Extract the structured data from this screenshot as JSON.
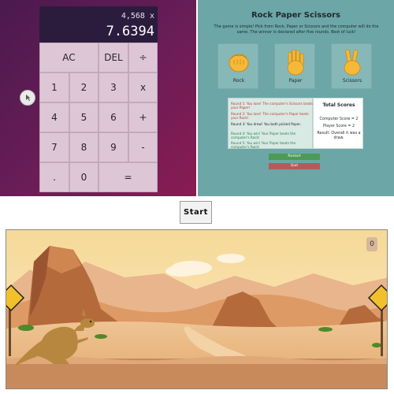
{
  "calculator": {
    "previous_operand": "4,568 x",
    "current_operand": "7.6394",
    "keys": {
      "ac": "AC",
      "del": "DEL",
      "divide": "÷",
      "one": "1",
      "two": "2",
      "three": "3",
      "multiply": "x",
      "four": "4",
      "five": "5",
      "six": "6",
      "add": "+",
      "seven": "7",
      "eight": "8",
      "nine": "9",
      "subtract": "-",
      "dot": ".",
      "zero": "0",
      "equals": "="
    },
    "colors": {
      "display": "#2b1c3e",
      "keys": "#ddc7d6",
      "background_from": "#4a1a4e",
      "background_to": "#8a1b52"
    }
  },
  "rps": {
    "title": "Rock Paper Scissors",
    "description": "The game is simple! Pick from Rock, Paper or Scissors and the computer will do the same. The winner is declared after five rounds. Best of luck!",
    "choices": [
      {
        "label": "Rock",
        "icon": "fist-icon"
      },
      {
        "label": "Paper",
        "icon": "open-hand-icon"
      },
      {
        "label": "Scissors",
        "icon": "victory-hand-icon"
      }
    ],
    "log": [
      {
        "text": "Round 1: You lose! The computer's Scissors beats your Paper!",
        "color": "#c0392b"
      },
      {
        "text": "Round 2: You lose! The computer's Paper beats your Rock!",
        "color": "#c0392b"
      },
      {
        "text": "Round 3: You drew! You both picked Paper.",
        "color": "#222222"
      },
      {
        "text": "Round 4: You win! Your Paper beats the computer's Rock!",
        "color": "#1e8449"
      },
      {
        "text": "Round 5: You win! Your Paper beats the computer's Rock!",
        "color": "#1e8449"
      }
    ],
    "score": {
      "title": "Total Scores",
      "computer": "Computer Score = 2",
      "player": "Player Score = 2",
      "result": "Result: Overall it was a draw."
    },
    "restart_label": "Restart",
    "quit_label": "Quit",
    "colors": {
      "background": "#6ca6a7",
      "restart": "#4c9a55",
      "quit": "#b55a5a"
    }
  },
  "game": {
    "start_label": "Start",
    "score": "0",
    "scene": "desert-kangaroo-scene"
  }
}
